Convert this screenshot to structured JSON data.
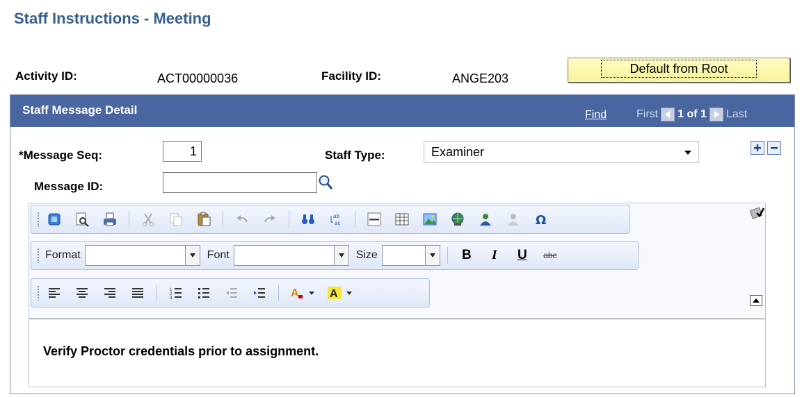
{
  "page": {
    "title": "Staff Instructions - Meeting"
  },
  "info": {
    "activity_label": "Activity ID:",
    "activity_value": "ACT00000036",
    "facility_label": "Facility ID:",
    "facility_value": "ANGE203",
    "default_button": "Default from Root"
  },
  "grid": {
    "header": "Staff Message Detail",
    "find": "Find",
    "first": "First",
    "count": "1 of 1",
    "last": "Last"
  },
  "form": {
    "msg_seq_label": "*Message Seq:",
    "msg_seq_value": "1",
    "staff_type_label": "Staff Type:",
    "staff_type_value": "Examiner",
    "message_id_label": "Message ID:",
    "message_id_value": ""
  },
  "editor": {
    "format_label": "Format",
    "font_label": "Font",
    "size_label": "Size",
    "format_value": "",
    "font_value": "",
    "size_value": "",
    "bold": "B",
    "italic": "I",
    "underline": "U",
    "strike": "abc",
    "body": "Verify Proctor credentials prior to assignment."
  },
  "colors": {
    "accent": "#4a66a0",
    "title": "#365f91",
    "button": "#f7f29a"
  }
}
